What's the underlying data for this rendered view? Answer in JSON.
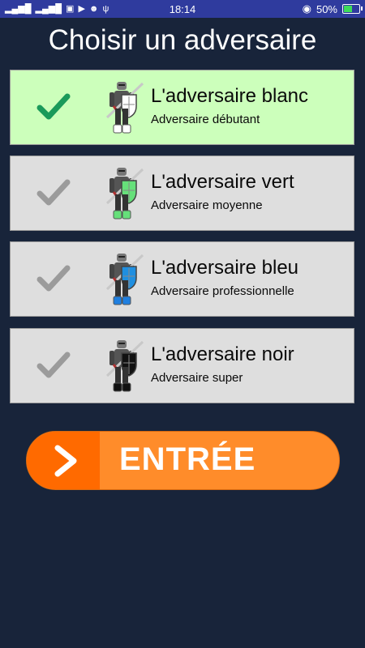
{
  "status_bar": {
    "time": "18:14",
    "battery": "50%"
  },
  "title": "Choisir un adversaire",
  "adversaries": [
    {
      "name": "L'adversaire blanc",
      "level": "Adversaire débutant",
      "selected": true,
      "shield_color": "#ffffff",
      "boot_color": "#ffffff"
    },
    {
      "name": "L'adversaire vert",
      "level": "Adversaire moyenne",
      "selected": false,
      "shield_color": "#66e07a",
      "boot_color": "#66e07a"
    },
    {
      "name": "L'adversaire bleu",
      "level": "Adversaire professionnelle",
      "selected": false,
      "shield_color": "#1f8fe0",
      "boot_color": "#1f7fe0"
    },
    {
      "name": "L'adversaire noir",
      "level": "Adversaire super",
      "selected": false,
      "shield_color": "#111111",
      "boot_color": "#111111"
    }
  ],
  "enter_button": {
    "label": "ENTRÉE"
  },
  "colors": {
    "background": "#18243a",
    "selected_card": "#ccffbb",
    "card": "#dedede",
    "check_selected": "#1a9a5a",
    "check_unselected": "#9b9b9b",
    "button": "#ff8c2a"
  }
}
